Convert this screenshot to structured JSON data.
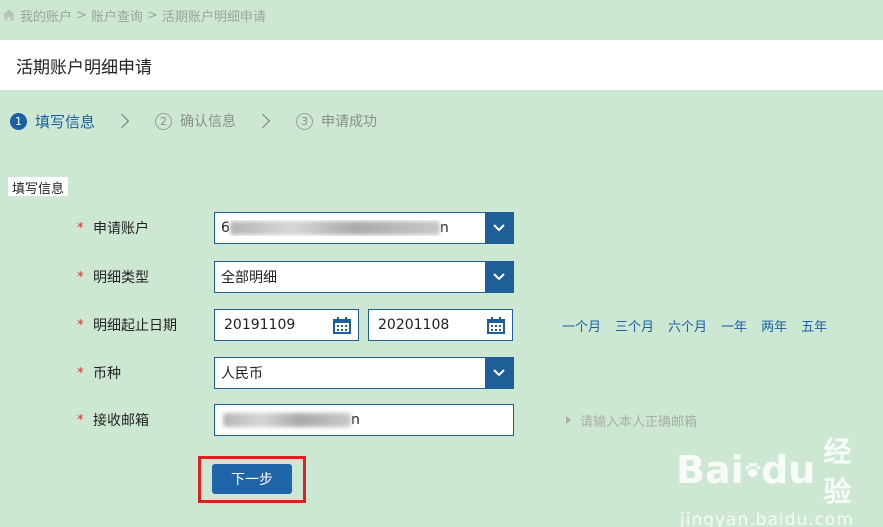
{
  "breadcrumb": {
    "items": [
      "我的账户",
      "账户查询",
      "活期账户明细申请"
    ],
    "separator": ">"
  },
  "page_title": "活期账户明细申请",
  "steps": [
    {
      "num": "1",
      "label": "填写信息"
    },
    {
      "num": "2",
      "label": "确认信息"
    },
    {
      "num": "3",
      "label": "申请成功"
    }
  ],
  "section_label": "填写信息",
  "form": {
    "required_mark": "*",
    "account": {
      "label": "申请账户",
      "value_visible": "6",
      "value_tail": "n"
    },
    "detail_type": {
      "label": "明细类型",
      "value": "全部明细"
    },
    "date_range": {
      "label": "明细起止日期",
      "start": "20191109",
      "end": "20201108"
    },
    "quick_ranges": [
      "一个月",
      "三个月",
      "六个月",
      "一年",
      "两年",
      "五年"
    ],
    "currency": {
      "label": "币种",
      "value": "人民币"
    },
    "email": {
      "label": "接收邮箱",
      "value_tail": "n",
      "hint": "请输入本人正确邮箱"
    }
  },
  "next_button_label": "下一步",
  "watermark": {
    "brand": "Bai",
    "brand_tail": "du",
    "brand_cn": "经验",
    "url": "jingyan.baidu.com"
  },
  "colors": {
    "background": "#cde8d2",
    "accent_blue": "#1f5f98",
    "required_red": "#d12b2b",
    "highlight_red": "#e02020"
  }
}
